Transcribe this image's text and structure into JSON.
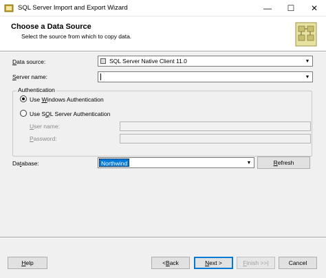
{
  "window": {
    "title": "SQL Server Import and Export Wizard",
    "minimize_glyph": "—",
    "maximize_glyph": "☐",
    "close_glyph": "✕"
  },
  "header": {
    "title": "Choose a Data Source",
    "subtitle": "Select the source from which to copy data."
  },
  "form": {
    "data_source_label_pre": "",
    "data_source_label_ul": "D",
    "data_source_label_post": "ata source:",
    "data_source_value": "SQL Server Native Client 11.0",
    "server_name_label_pre": "",
    "server_name_label_ul": "S",
    "server_name_label_post": "erver name:",
    "server_name_value": "",
    "auth_group_label": "Authentication",
    "windows_auth_pre": "Use ",
    "windows_auth_ul": "W",
    "windows_auth_post": "indows Authentication",
    "sql_auth_pre": "Use S",
    "sql_auth_ul": "Q",
    "sql_auth_post": "L Server Authentication",
    "selected_auth": "windows",
    "username_label_pre": "",
    "username_label_ul": "U",
    "username_label_post": "ser name:",
    "password_label_pre": "",
    "password_label_ul": "P",
    "password_label_post": "assword:",
    "database_label_pre": "Da",
    "database_label_ul": "t",
    "database_label_post": "abase:",
    "database_value": "Northwind",
    "refresh_pre": "",
    "refresh_ul": "R",
    "refresh_post": "efresh"
  },
  "footer": {
    "help_pre": "",
    "help_ul": "H",
    "help_post": "elp",
    "back_pre": "< ",
    "back_ul": "B",
    "back_post": "ack",
    "next_pre": "",
    "next_ul": "N",
    "next_post": "ext >",
    "finish_pre": "",
    "finish_ul": "F",
    "finish_post": "inish >>|",
    "cancel_label": "Cancel"
  },
  "colors": {
    "accent": "#0078d7",
    "dialog_bg": "#f0f0f0"
  },
  "icons": {
    "app": "wizard-app-icon",
    "header": "data-transfer-graphic-icon",
    "provider": "database-provider-icon",
    "dropdown": "chevron-down-icon"
  }
}
